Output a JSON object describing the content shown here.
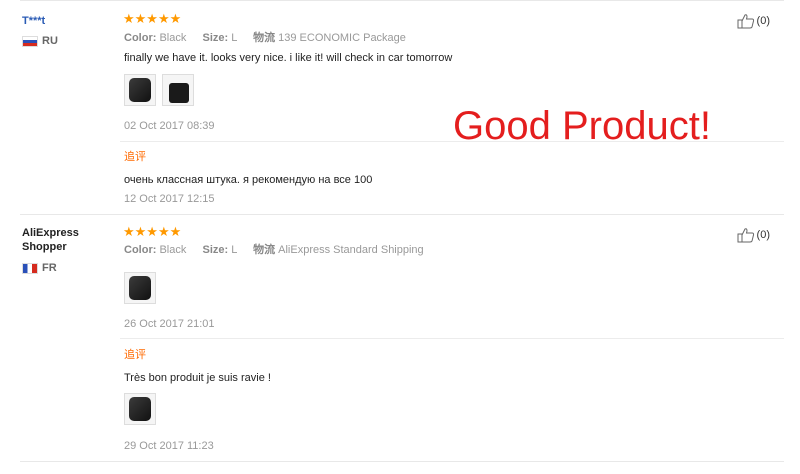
{
  "banner": "Good Product!",
  "reviews": [
    {
      "user": "T***t",
      "country": "RU",
      "stars": "★★★★★",
      "color_label": "Color:",
      "color_value": "Black",
      "size_label": "Size:",
      "size_value": "L",
      "shipping_label": "物流",
      "shipping_value": "139 ECONOMIC Package",
      "text": "finally we have it. looks very nice. i like it! will check in car tomorrow",
      "date": "02 Oct 2017 08:39",
      "followup_label": "追评",
      "followup_text": "очень классная штука. я рекомендую на все 100",
      "followup_date": "12 Oct 2017 12:15",
      "helpful": "(0)"
    },
    {
      "user": "AliExpress Shopper",
      "country": "FR",
      "stars": "★★★★★",
      "color_label": "Color:",
      "color_value": "Black",
      "size_label": "Size:",
      "size_value": "L",
      "shipping_label": "物流",
      "shipping_value": "AliExpress Standard Shipping",
      "text": "",
      "date": "26 Oct 2017 21:01",
      "followup_label": "追评",
      "followup_text": "Très bon produit je suis ravie !",
      "followup_date": "29 Oct 2017 11:23",
      "helpful": "(0)"
    }
  ],
  "colors": {
    "star": "#ff9900",
    "followup": "#ff6a00",
    "banner": "#e41e1e",
    "username": "#2a5bb5"
  },
  "icons": {
    "helpful": "thumbs-up-icon"
  }
}
